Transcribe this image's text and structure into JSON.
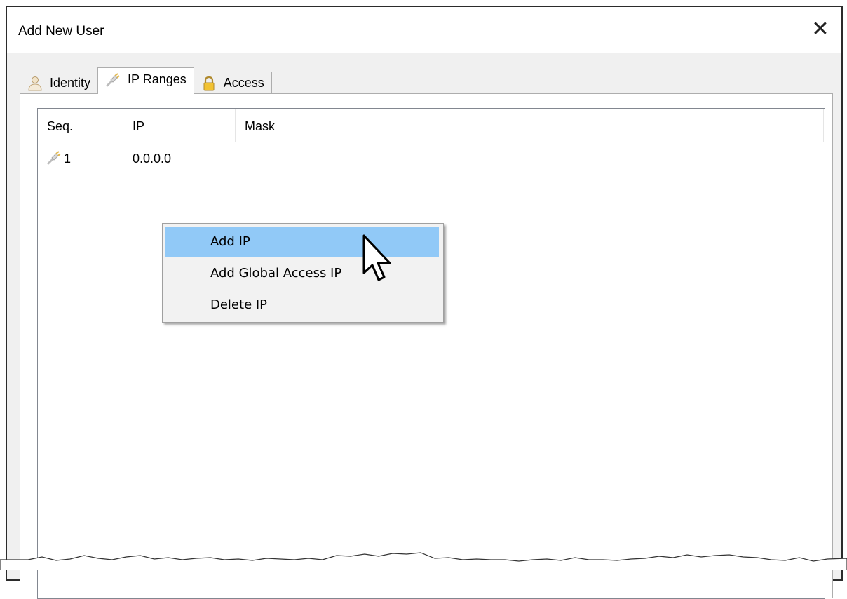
{
  "window": {
    "title": "Add New User",
    "close_glyph": "✕"
  },
  "tabs": [
    {
      "label": "Identity",
      "icon": "user-icon",
      "active": false
    },
    {
      "label": "IP Ranges",
      "icon": "network-plug-icon",
      "active": true
    },
    {
      "label": "Access",
      "icon": "lock-icon",
      "active": false
    }
  ],
  "list": {
    "columns": [
      "Seq.",
      "IP",
      "Mask"
    ],
    "rows": [
      {
        "seq": "1",
        "ip": "0.0.0.0",
        "mask": "",
        "icon": "network-plug-icon"
      }
    ]
  },
  "context_menu": {
    "items": [
      {
        "label": "Add IP",
        "highlighted": true
      },
      {
        "label": "Add Global Access IP",
        "highlighted": false
      },
      {
        "label": "Delete IP",
        "highlighted": false
      }
    ]
  },
  "colors": {
    "menu_highlight": "#91c9f7",
    "window_bg": "#f0f0f0"
  }
}
